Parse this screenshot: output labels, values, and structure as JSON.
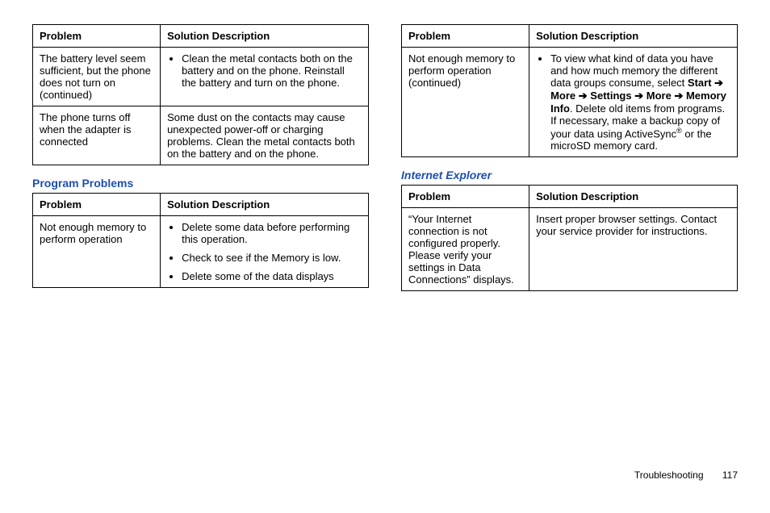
{
  "left": {
    "table1": {
      "headers": {
        "problem": "Problem",
        "solution": "Solution Description"
      },
      "rows": [
        {
          "problem": "The battery level seem sufficient, but the phone does not turn on (continued)",
          "bullets": [
            "Clean the metal contacts both on the battery and on the phone. Reinstall the battery and turn on the phone."
          ]
        },
        {
          "problem": "The phone turns off when the adapter is connected",
          "text": "Some dust on the contacts may cause unexpected power-off or charging problems. Clean the metal contacts both on the battery and on the phone."
        }
      ]
    },
    "heading1": "Program Problems",
    "table2": {
      "headers": {
        "problem": "Problem",
        "solution": "Solution Description"
      },
      "rows": [
        {
          "problem": "Not enough memory to perform operation",
          "bullets": [
            "Delete some data before performing this operation.",
            "Check to see if the Memory is low.",
            "Delete some of the data displays"
          ]
        }
      ]
    }
  },
  "right": {
    "table1": {
      "headers": {
        "problem": "Problem",
        "solution": "Solution Description"
      },
      "rows": [
        {
          "problem": "Not enough memory to perform operation (continued)",
          "memory_pre": "To view what kind of data you have and how much memory the different data groups consume, select ",
          "path": {
            "p1": "Start",
            "p2": "More",
            "p3": "Settings",
            "p4": "More",
            "p5": "Memory Info"
          },
          "memory_post": ".   Delete old items from programs. If necessary, make a backup copy of your data using ActiveSync",
          "memory_post2": " or the microSD memory card."
        }
      ]
    },
    "heading1": "Internet Explorer",
    "table2": {
      "headers": {
        "problem": "Problem",
        "solution": "Solution Description"
      },
      "rows": [
        {
          "problem": "“Your Internet connection is not configured properly. Please verify your settings in Data Connections” displays.",
          "text": "Insert proper browser settings. Contact your service provider for instructions."
        }
      ]
    }
  },
  "footer": {
    "section": "Troubleshooting",
    "page": "117"
  }
}
